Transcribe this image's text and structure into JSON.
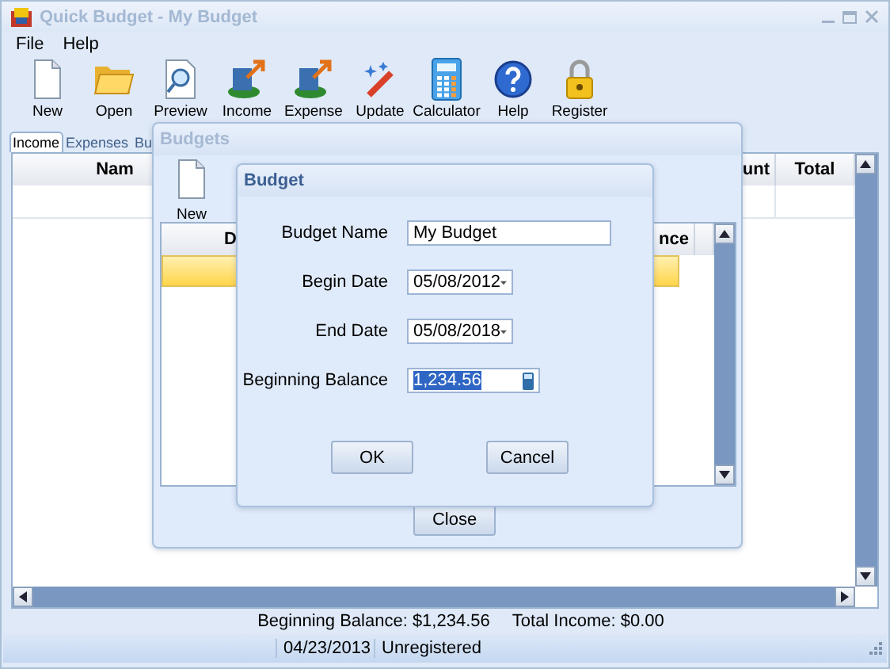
{
  "window": {
    "title": "Quick Budget - My Budget"
  },
  "menu": [
    "File",
    "Help"
  ],
  "toolbar": [
    {
      "label": "New"
    },
    {
      "label": "Open"
    },
    {
      "label": "Preview"
    },
    {
      "label": "Income"
    },
    {
      "label": "Expense"
    },
    {
      "label": "Update"
    },
    {
      "label": "Calculator"
    },
    {
      "label": "Help"
    },
    {
      "label": "Register"
    }
  ],
  "tabs": [
    {
      "label": "Income",
      "selected": true
    },
    {
      "label": "Expenses",
      "selected": false
    },
    {
      "label": "Bu",
      "selected": false
    }
  ],
  "income_table": {
    "columns": [
      "Nam",
      "unt",
      "Total"
    ]
  },
  "summary": [
    "Beginning Balance: $1,234.56",
    "Total Income: $0.00"
  ],
  "status_bar": [
    "04/23/2013",
    "Unregistered"
  ],
  "budgets_dialog": {
    "title": "Budgets",
    "toolbar": [
      {
        "label": "New"
      }
    ],
    "columns": [
      "D",
      "nce"
    ],
    "rows": [
      {
        "selected": true
      }
    ],
    "close_button": "Close"
  },
  "budget_dialog": {
    "title": "Budget",
    "fields": [
      {
        "kind": "text",
        "label": "Budget Name",
        "value": "My Budget",
        "highlighted": false
      },
      {
        "kind": "date",
        "label": "Begin Date",
        "value": "05/08/2012",
        "highlighted": false
      },
      {
        "kind": "date",
        "label": "End Date",
        "value": "05/08/2018",
        "highlighted": false
      },
      {
        "kind": "calc",
        "label": "Beginning Balance",
        "value": "1,234.56",
        "highlighted": true
      }
    ],
    "buttons": [
      "OK",
      "Cancel"
    ]
  }
}
